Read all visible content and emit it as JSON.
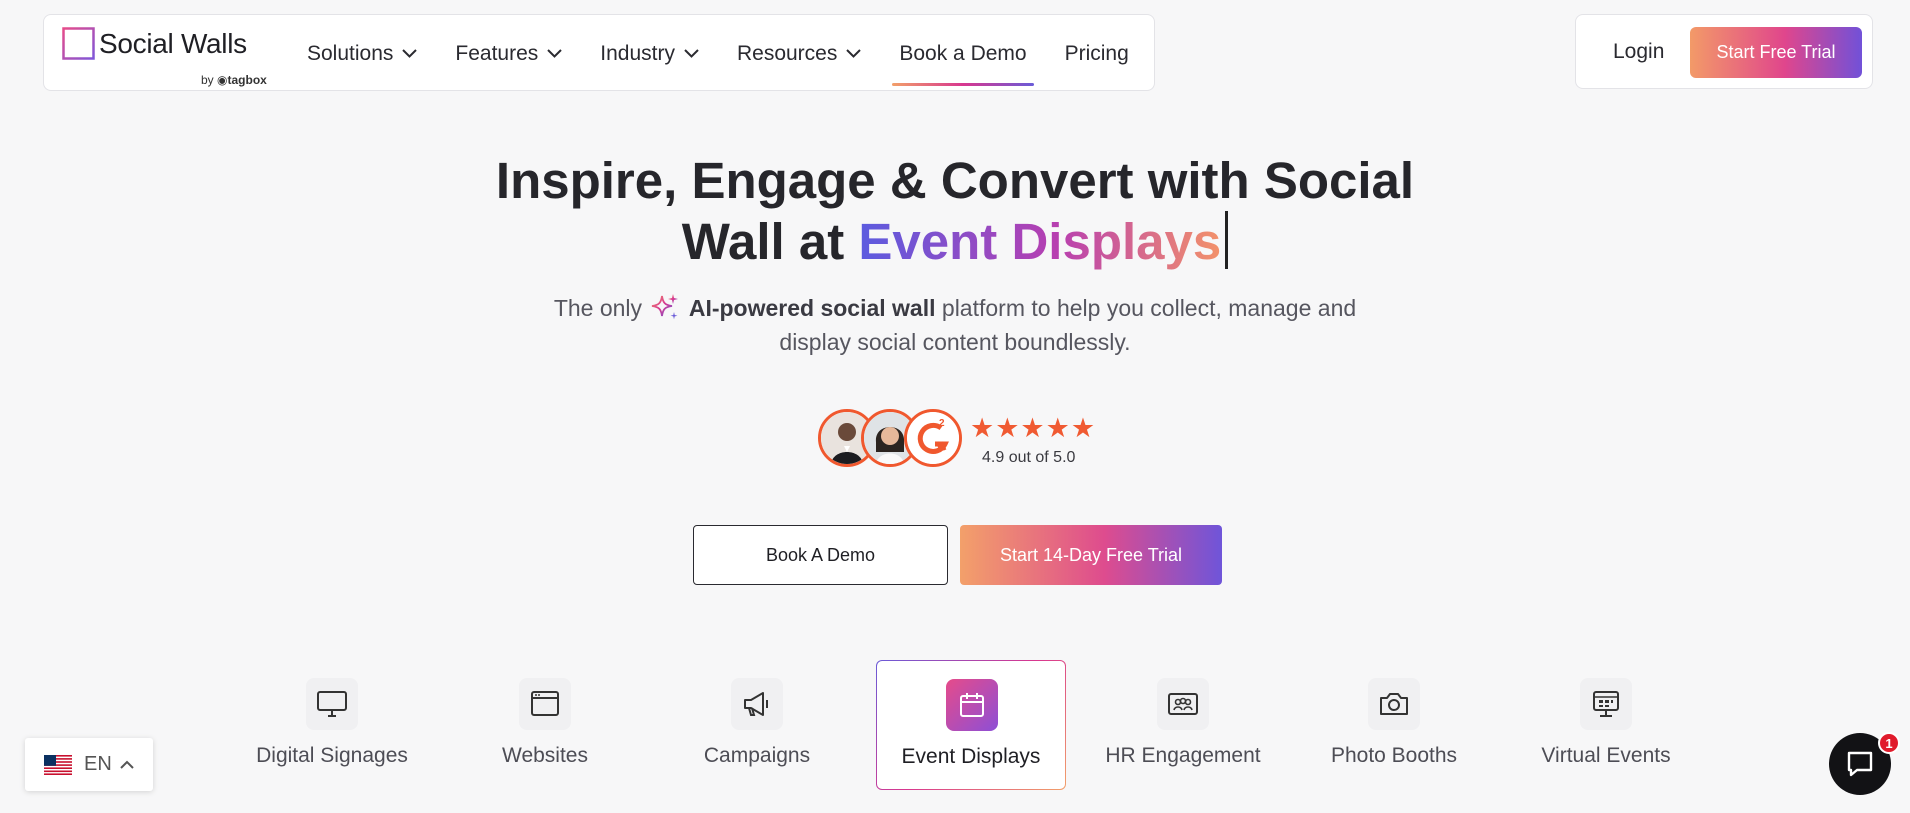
{
  "brand": {
    "name": "Social Walls",
    "by_prefix": "by",
    "by_brand": "tagbox",
    "logo_colors": [
      "#d8378f",
      "#7f56d9"
    ]
  },
  "nav": {
    "items": [
      {
        "label": "Solutions",
        "has_dropdown": true
      },
      {
        "label": "Features",
        "has_dropdown": true
      },
      {
        "label": "Industry",
        "has_dropdown": true
      },
      {
        "label": "Resources",
        "has_dropdown": true
      },
      {
        "label": "Book a Demo",
        "has_dropdown": false,
        "active": true
      },
      {
        "label": "Pricing",
        "has_dropdown": false
      }
    ],
    "login_label": "Login",
    "trial_label": "Start Free Trial"
  },
  "hero": {
    "title_line1": "Inspire, Engage & Convert with Social",
    "title_line2_prefix": "Wall at ",
    "title_highlight": "Event Displays",
    "sub_prefix": "The only",
    "sub_bold": "AI-powered social wall",
    "sub_rest": "platform to help you collect, manage and",
    "sub_line2": "display social content boundlessly."
  },
  "rating": {
    "stars": "★★★★★",
    "value": 4.9,
    "max": 5.0,
    "text": "4.9 out of 5.0",
    "badge_icon": "g2-logo-icon"
  },
  "cta": {
    "demo_label": "Book A Demo",
    "trial_label": "Start 14-Day Free Trial"
  },
  "categories": [
    {
      "label": "Digital Signages",
      "icon": "monitor-icon"
    },
    {
      "label": "Websites",
      "icon": "browser-window-icon"
    },
    {
      "label": "Campaigns",
      "icon": "megaphone-icon"
    },
    {
      "label": "Event Displays",
      "icon": "calendar-icon",
      "active": true
    },
    {
      "label": "HR Engagement",
      "icon": "people-card-icon"
    },
    {
      "label": "Photo Booths",
      "icon": "camera-icon"
    },
    {
      "label": "Virtual Events",
      "icon": "virtual-screen-icon"
    }
  ],
  "language": {
    "code": "EN",
    "flag": "us-flag-icon"
  },
  "chat": {
    "badge_count": "1",
    "icon": "chat-bubble-icon"
  },
  "colors": {
    "accent_start": "#f3a06a",
    "accent_mid": "#de4c8e",
    "accent_end": "#6f55d9",
    "star": "#f05a32"
  }
}
